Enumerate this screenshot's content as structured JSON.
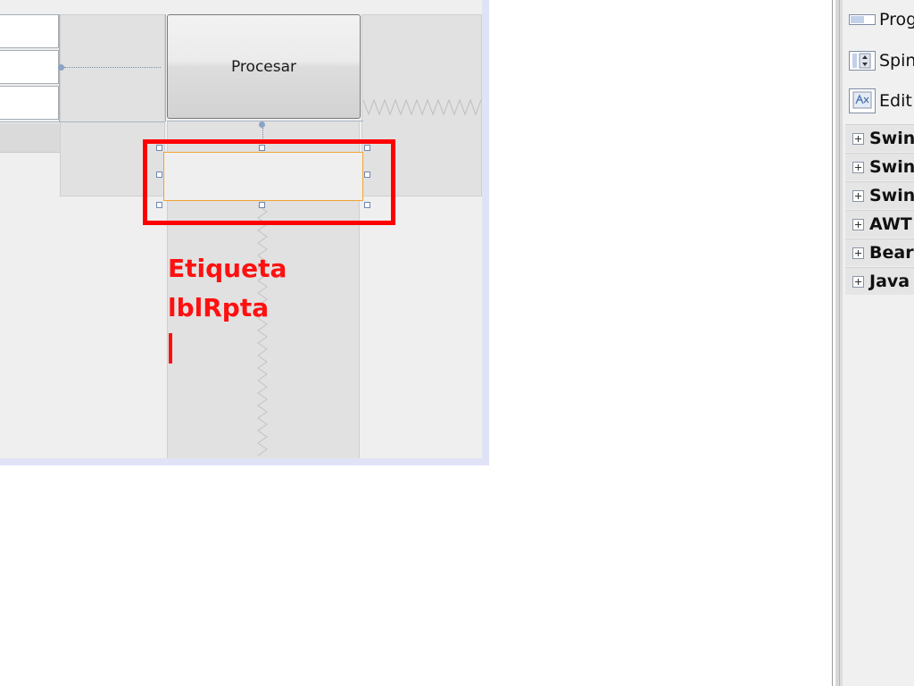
{
  "canvas": {
    "button_label": "Procesar",
    "annotation": {
      "line1": "Etiqueta",
      "line2": "lblRpta"
    }
  },
  "palette": {
    "items": [
      {
        "label": "Prog",
        "icon": "progress-bar-icon"
      },
      {
        "label": "Spin",
        "icon": "spinner-icon"
      },
      {
        "label": "Edit",
        "icon": "editor-pane-icon"
      }
    ],
    "categories": [
      {
        "label": "Swin"
      },
      {
        "label": "Swin"
      },
      {
        "label": "Swin"
      },
      {
        "label": "AWT"
      },
      {
        "label": "Bear"
      },
      {
        "label": "Java"
      }
    ]
  },
  "colors": {
    "annotation_red": "#ff1010",
    "selection_orange": "#f0a330",
    "canvas_border": "#e0e3f6"
  }
}
